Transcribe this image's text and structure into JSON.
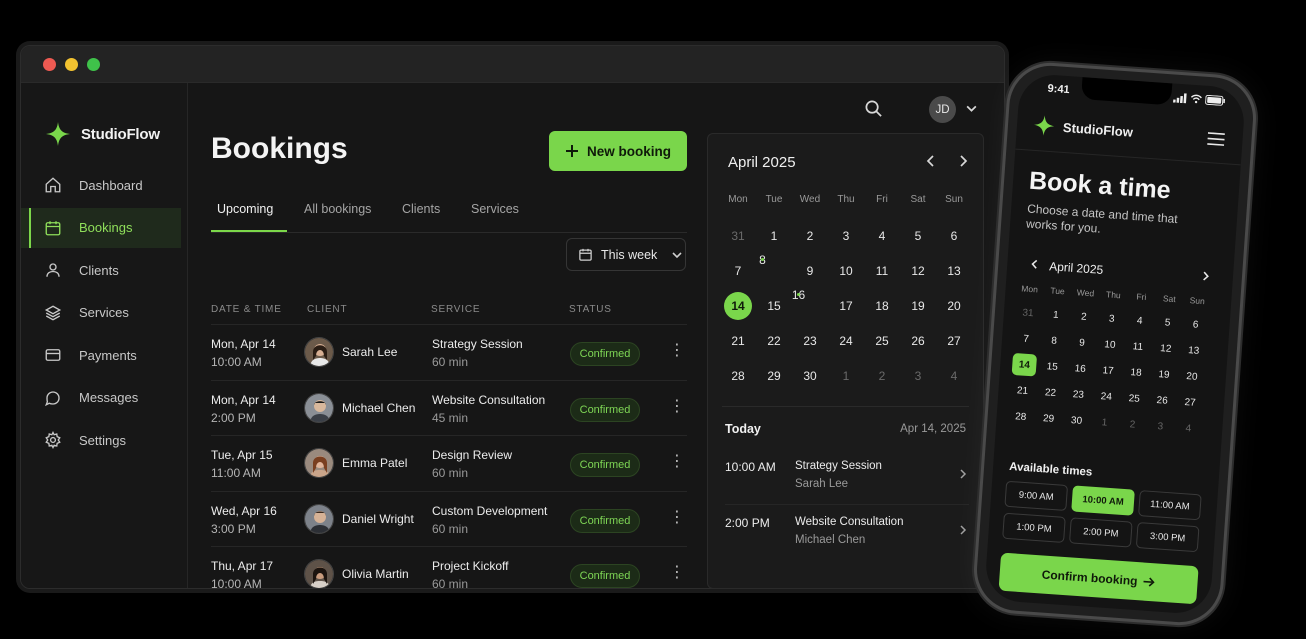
{
  "app": {
    "name": "StudioFlow",
    "accent": "#7ad64b"
  },
  "sidebar": {
    "items": [
      {
        "label": "Dashboard",
        "icon": "home-icon"
      },
      {
        "label": "Bookings",
        "icon": "calendar-icon",
        "active": true
      },
      {
        "label": "Clients",
        "icon": "user-icon"
      },
      {
        "label": "Services",
        "icon": "layers-icon"
      },
      {
        "label": "Payments",
        "icon": "card-icon"
      },
      {
        "label": "Messages",
        "icon": "chat-icon"
      },
      {
        "label": "Settings",
        "icon": "gear-icon"
      }
    ]
  },
  "header": {
    "title": "Bookings",
    "new_button": "New booking",
    "avatar_initials": "JD"
  },
  "tabs": [
    "Upcoming",
    "All bookings",
    "Clients",
    "Services"
  ],
  "filter": {
    "label": "This week"
  },
  "table": {
    "columns": [
      "DATE & TIME",
      "CLIENT",
      "SERVICE",
      "STATUS"
    ],
    "rows": [
      {
        "date": "Mon, Apr 14",
        "time": "10:00 AM",
        "client": "Sarah Lee",
        "service": "Strategy Session",
        "duration": "60 min",
        "status": "Confirmed"
      },
      {
        "date": "Mon, Apr 14",
        "time": "2:00 PM",
        "client": "Michael Chen",
        "service": "Website Consultation",
        "duration": "45 min",
        "status": "Confirmed"
      },
      {
        "date": "Tue, Apr 15",
        "time": "11:00 AM",
        "client": "Emma Patel",
        "service": "Design Review",
        "duration": "60 min",
        "status": "Confirmed"
      },
      {
        "date": "Wed, Apr 16",
        "time": "3:00 PM",
        "client": "Daniel Wright",
        "service": "Custom Development",
        "duration": "60 min",
        "status": "Confirmed"
      },
      {
        "date": "Thu, Apr 17",
        "time": "10:00 AM",
        "client": "Olivia Martin",
        "service": "Project Kickoff",
        "duration": "60 min",
        "status": "Confirmed"
      }
    ]
  },
  "calendar": {
    "title": "April 2025",
    "dow": [
      "Mon",
      "Tue",
      "Wed",
      "Thu",
      "Fri",
      "Sat",
      "Sun"
    ],
    "days": [
      "31",
      "1",
      "2",
      "3",
      "4",
      "5",
      "6",
      "7",
      "8",
      "9",
      "10",
      "11",
      "12",
      "13",
      "14",
      "15",
      "16",
      "17",
      "18",
      "19",
      "20",
      "21",
      "22",
      "23",
      "24",
      "25",
      "26",
      "27",
      "28",
      "29",
      "30",
      "1",
      "2",
      "3",
      "4"
    ],
    "muted_indices": [
      0,
      31,
      32,
      33,
      34
    ],
    "selected_index": 14,
    "event_dot_indices": [
      8,
      16
    ],
    "today_label": "Today",
    "today_date": "Apr 14, 2025",
    "appointments": [
      {
        "time": "10:00 AM",
        "service": "Strategy Session",
        "client": "Sarah Lee"
      },
      {
        "time": "2:00 PM",
        "service": "Website Consultation",
        "client": "Michael Chen"
      }
    ]
  },
  "mobile": {
    "status_time": "9:41",
    "brand": "StudioFlow",
    "title": "Book a time",
    "subtitle": "Choose a date and time that works for you.",
    "calendar_title": "April 2025",
    "available_label": "Available times",
    "slots": [
      "9:00 AM",
      "10:00 AM",
      "11:00 AM",
      "1:00 PM",
      "2:00 PM",
      "3:00 PM"
    ],
    "selected_slot": 1,
    "confirm_label": "Confirm booking"
  }
}
